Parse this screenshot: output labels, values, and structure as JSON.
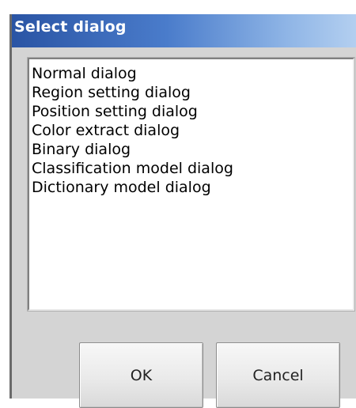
{
  "dialog": {
    "title": "Select dialog",
    "items": [
      "Normal dialog",
      "Region setting dialog",
      "Position setting dialog",
      "Color extract dialog",
      "Binary dialog",
      "Classification model dialog",
      "Dictionary model dialog"
    ],
    "ok_label": "OK",
    "cancel_label": "Cancel"
  },
  "colors": {
    "titlebar_start": "#2a54a4",
    "titlebar_end": "#b3cff0",
    "dialog_bg": "#d4d4d4"
  }
}
